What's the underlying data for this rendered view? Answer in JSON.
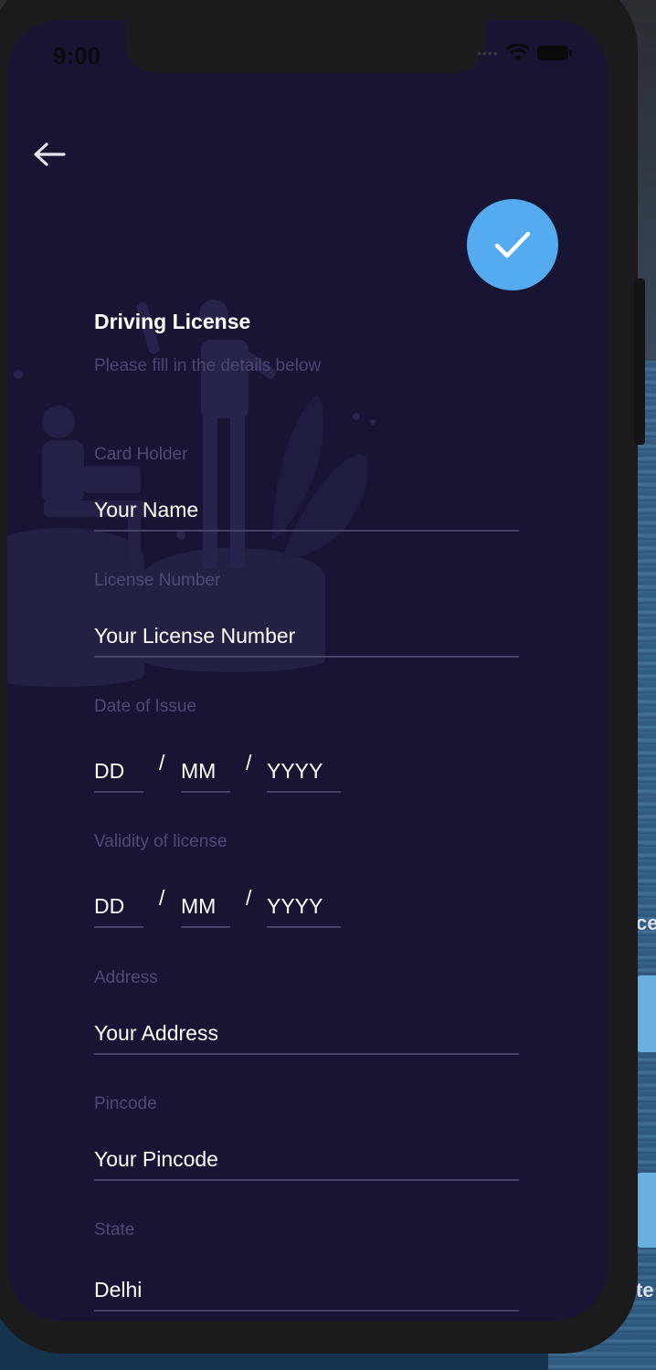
{
  "status_bar": {
    "time": "9:00"
  },
  "header": {
    "back_icon": "arrow-left-icon",
    "confirm_icon": "checkmark-icon"
  },
  "form": {
    "title": "Driving License",
    "subtitle": "Please fill in the details below",
    "card_holder": {
      "label": "Card Holder",
      "placeholder": "Your Name"
    },
    "license_number": {
      "label": "License Number",
      "placeholder": "Your License Number"
    },
    "date_of_issue": {
      "label": "Date of Issue",
      "day": "DD",
      "month": "MM",
      "year": "YYYY",
      "separator": "/"
    },
    "validity": {
      "label": "Validity of license",
      "day": "DD",
      "month": "MM",
      "year": "YYYY",
      "separator": "/"
    },
    "address": {
      "label": "Address",
      "placeholder": "Your Address"
    },
    "pincode": {
      "label": "Pincode",
      "placeholder": "Your Pincode"
    },
    "state": {
      "label": "State",
      "value": "Delhi"
    }
  },
  "background_app": {
    "text_1": "ce",
    "text_2": "te"
  },
  "colors": {
    "accent": "#55abf0",
    "screen_bg": "#171533",
    "label": "#4e4c72"
  }
}
